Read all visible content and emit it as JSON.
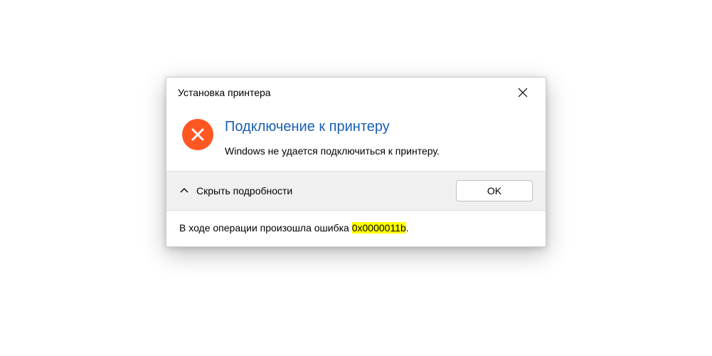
{
  "dialog": {
    "title": "Установка принтера",
    "heading": "Подключение к принтеру",
    "message": "Windows не удается подключиться к принтеру.",
    "toggle_label": "Скрыть подробности",
    "ok_label": "OK",
    "details_prefix": "В ходе операции произошла ошибка ",
    "error_code": "0x0000011b",
    "details_suffix": ".",
    "colors": {
      "error_icon": "#ff5722",
      "heading": "#1a5fb4",
      "highlight": "#ffff00"
    }
  }
}
